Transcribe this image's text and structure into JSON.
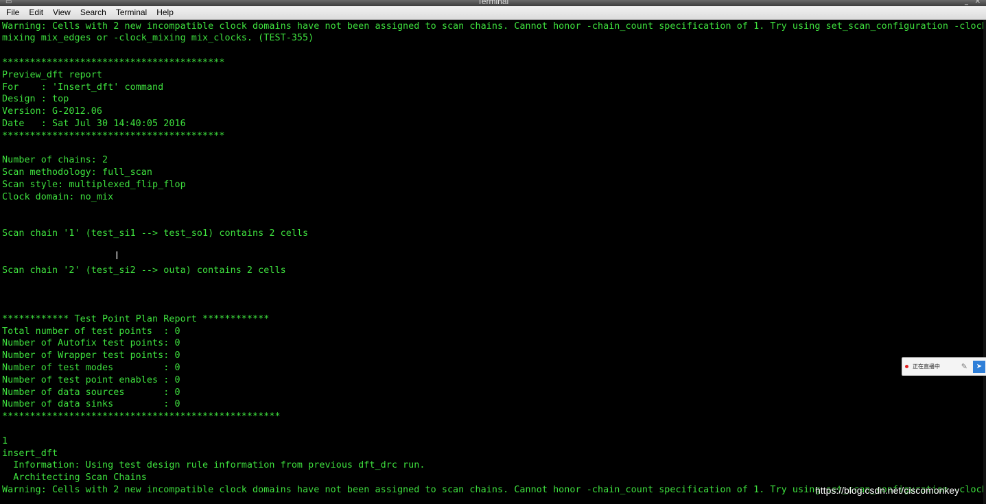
{
  "window": {
    "title": "Terminal",
    "menu": [
      "File",
      "Edit",
      "View",
      "Search",
      "Terminal",
      "Help"
    ]
  },
  "terminal": {
    "lines": [
      "Warning: Cells with 2 new incompatible clock domains have not been assigned to scan chains. Cannot honor -chain_count specification of 1. Try using set_scan_configuration -clock",
      "mixing mix_edges or -clock_mixing mix_clocks. (TEST-355)",
      "",
      "****************************************",
      "Preview_dft report",
      "For    : 'Insert_dft' command",
      "Design : top",
      "Version: G-2012.06",
      "Date   : Sat Jul 30 14:40:05 2016",
      "****************************************",
      "",
      "Number of chains: 2",
      "Scan methodology: full_scan",
      "Scan style: multiplexed_flip_flop",
      "Clock domain: no_mix",
      "",
      "",
      "Scan chain '1' (test_si1 --> test_so1) contains 2 cells",
      "",
      "",
      "Scan chain '2' (test_si2 --> outa) contains 2 cells",
      "",
      "",
      "",
      "************ Test Point Plan Report ************",
      "Total number of test points  : 0",
      "Number of Autofix test points: 0",
      "Number of Wrapper test points: 0",
      "Number of test modes         : 0",
      "Number of test point enables : 0",
      "Number of data sources       : 0",
      "Number of data sinks         : 0",
      "**************************************************",
      "",
      "1",
      "insert_dft",
      "  Information: Using test design rule information from previous dft_drc run.",
      "  Architecting Scan Chains",
      "Warning: Cells with 2 new incompatible clock domains have not been assigned to scan chains. Cannot honor -chain_count specification of 1. Try using set_scan_configuration -clock"
    ]
  },
  "overlay": {
    "live_label": "正在直播中",
    "watermark": "https://blog.csdn.net/ciscomonkey"
  },
  "colors": {
    "terminal_bg": "#000000",
    "terminal_fg": "#3ee03e"
  }
}
